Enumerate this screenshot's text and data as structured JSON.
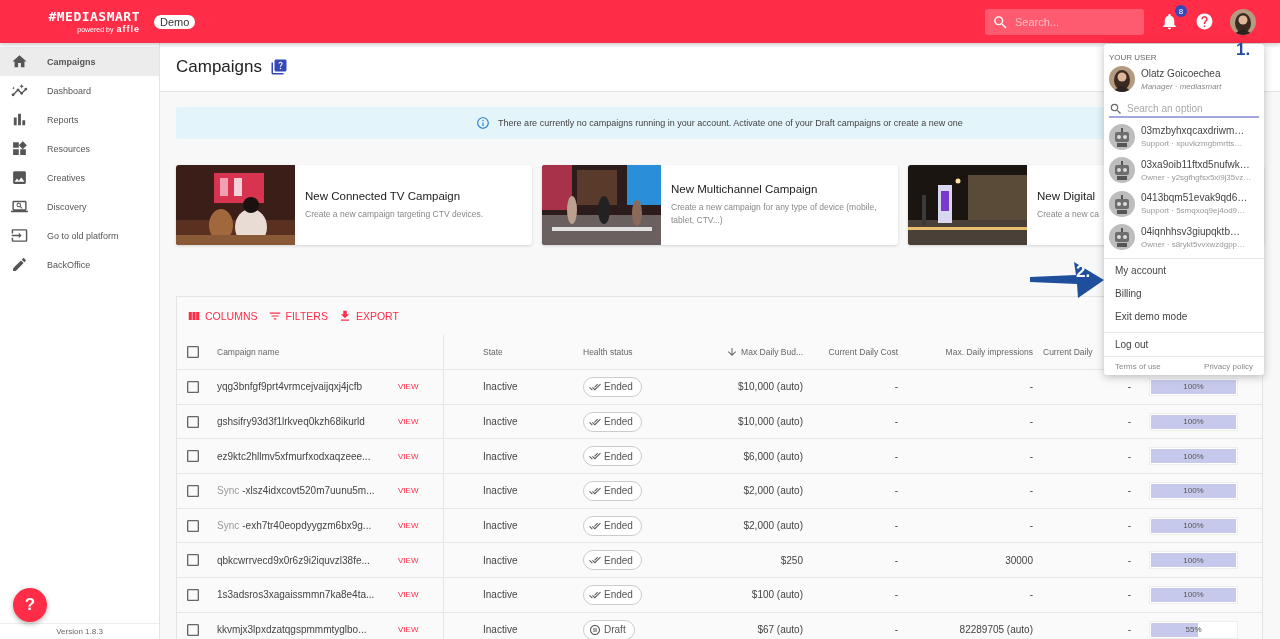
{
  "header": {
    "logo": "#MEDIASMART",
    "logo_sub": "powered by",
    "logo_brand": "affle",
    "badge": "Demo",
    "search": {
      "placeholder": "Search..."
    },
    "notification_count": "8"
  },
  "sidebar": {
    "items": [
      {
        "label": "Campaigns",
        "selected": true
      },
      {
        "label": "Dashboard",
        "selected": false
      },
      {
        "label": "Reports",
        "selected": false
      },
      {
        "label": "Resources",
        "selected": false
      },
      {
        "label": "Creatives",
        "selected": false
      },
      {
        "label": "Discovery",
        "selected": false
      },
      {
        "label": "Go to old platform",
        "selected": false
      },
      {
        "label": "BackOffice",
        "selected": false
      }
    ],
    "version": "Version 1.8.3",
    "help_button": "?"
  },
  "page": {
    "title": "Campaigns",
    "info": "There are currently no campaigns running in your account. Activate one of your Draft campaigns or create a new one",
    "cards": [
      {
        "title": "New Connected TV Campaign",
        "description": "Create a new campaign targeting CTV devices.",
        "kind": "picture"
      },
      {
        "title": "New Multichannel Campaign",
        "description": "Create a new campaign for any type of device (mobile, tablet, CTV...)",
        "kind": "picture"
      },
      {
        "title": "New Digital",
        "description": "Create a new ca",
        "kind": "picture"
      }
    ]
  },
  "table": {
    "toolbar": [
      "COLUMNS",
      "FILTERS",
      "EXPORT"
    ],
    "all_selected": false,
    "columns": [
      "Campaign name",
      "State",
      "Health status",
      "Max Daily Bud...",
      "Current Daily Cost",
      "Max. Daily impressions",
      "Current Daily"
    ],
    "rows": [
      {
        "selected": false,
        "prefix": "",
        "name": "yqg3bnfgf9prt4vrmcejvaijqxj4jcfb",
        "view": "VIEW",
        "state": "Inactive",
        "health": {
          "kind": "ended",
          "label": "Ended"
        },
        "budget": "$10,000 (auto)",
        "cost": "-",
        "impressions": "-",
        "current": "-",
        "pacing": {
          "level": 1,
          "label": "100%"
        }
      },
      {
        "selected": false,
        "prefix": "",
        "name": "gshsifry93d3f1lrkveq0kzh68ikurld",
        "view": "VIEW",
        "state": "Inactive",
        "health": {
          "kind": "ended",
          "label": "Ended"
        },
        "budget": "$10,000 (auto)",
        "cost": "-",
        "impressions": "-",
        "current": "-",
        "pacing": {
          "level": 1,
          "label": "100%"
        }
      },
      {
        "selected": false,
        "prefix": "",
        "name": "ez9ktc2hllmv5xfmurfxodxaqzeee...",
        "view": "VIEW",
        "state": "Inactive",
        "health": {
          "kind": "ended",
          "label": "Ended"
        },
        "budget": "$6,000 (auto)",
        "cost": "-",
        "impressions": "-",
        "current": "-",
        "pacing": {
          "level": 1,
          "label": "100%"
        }
      },
      {
        "selected": false,
        "prefix": "Sync",
        "name": "-xlsz4idxcovt520m7uunu5m...",
        "view": "VIEW",
        "state": "Inactive",
        "health": {
          "kind": "ended",
          "label": "Ended"
        },
        "budget": "$2,000 (auto)",
        "cost": "-",
        "impressions": "-",
        "current": "-",
        "pacing": {
          "level": 1,
          "label": "100%"
        }
      },
      {
        "selected": false,
        "prefix": "Sync",
        "name": "-exh7tr40eopdyygzm6bx9g...",
        "view": "VIEW",
        "state": "Inactive",
        "health": {
          "kind": "ended",
          "label": "Ended"
        },
        "budget": "$2,000 (auto)",
        "cost": "-",
        "impressions": "-",
        "current": "-",
        "pacing": {
          "level": 1,
          "label": "100%"
        }
      },
      {
        "selected": false,
        "prefix": "",
        "name": "qbkcwrrvecd9x0r6z9i2iquvzl38fe...",
        "view": "VIEW",
        "state": "Inactive",
        "health": {
          "kind": "ended",
          "label": "Ended"
        },
        "budget": "$250",
        "cost": "-",
        "impressions": "30000",
        "current": "-",
        "pacing": {
          "level": 1,
          "label": "100%"
        }
      },
      {
        "selected": false,
        "prefix": "",
        "name": "1s3adsros3xagaissmmn7ka8e4ta...",
        "view": "VIEW",
        "state": "Inactive",
        "health": {
          "kind": "ended",
          "label": "Ended"
        },
        "budget": "$100 (auto)",
        "cost": "-",
        "impressions": "-",
        "current": "-",
        "pacing": {
          "level": 1,
          "label": "100%"
        }
      },
      {
        "selected": false,
        "prefix": "",
        "name": "kkvmjx3lpxdzatqgspmmmtyglbo...",
        "view": "VIEW",
        "state": "Inactive",
        "health": {
          "kind": "draft",
          "label": "Draft"
        },
        "budget": "$67 (auto)",
        "cost": "-",
        "impressions": "82289705 (auto)",
        "current": "-",
        "pacing": {
          "level": 0.55,
          "label": "55%"
        }
      }
    ]
  },
  "user_menu": {
    "section": "YOUR USER",
    "name": "Olatz Goicoechea",
    "role": "Manager · mediasmart",
    "search": {
      "placeholder": "Search an option"
    },
    "accounts": [
      {
        "name": "03mzbyhxqcaxdriwm…",
        "detail": "Support · xpuvkzmgbmrtts…"
      },
      {
        "name": "03xa9oib11ftxd5nufwk…",
        "detail": "Owner · y2sgfhgfsx5xl9j35vz…"
      },
      {
        "name": "0413bqm51evak9qd6…",
        "detail": "Support · 5smqxoq9ej4od9…"
      },
      {
        "name": "04iqnhhsv3giupqktb…",
        "detail": "Owner · s8rykt5vvxwzdgpp…"
      }
    ],
    "items": [
      "My account",
      "Billing",
      "Exit demo mode"
    ],
    "logout": "Log out",
    "footer": [
      "Terms of use",
      "Privacy policy"
    ]
  },
  "annotations": [
    "1.",
    "2."
  ]
}
